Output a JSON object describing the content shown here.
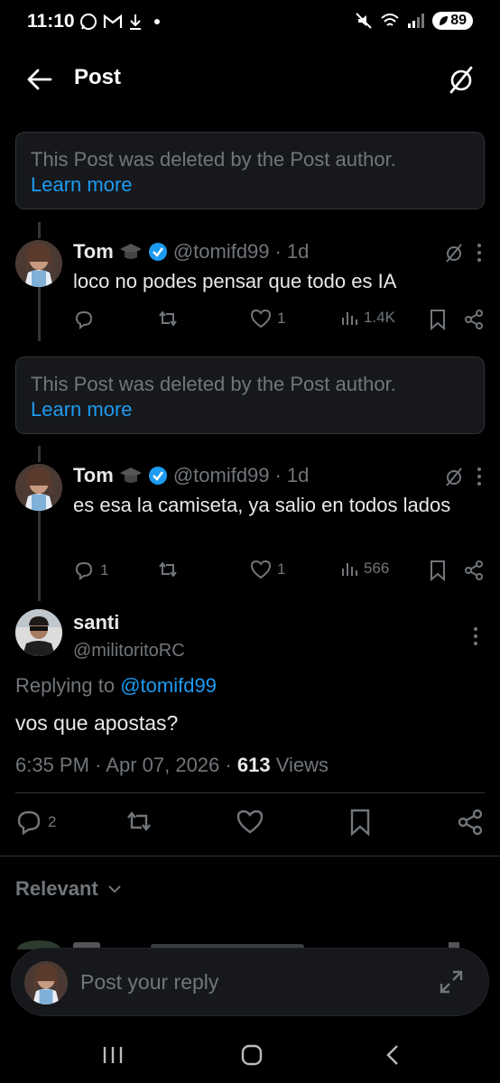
{
  "status_bar": {
    "time": "11:10",
    "battery": "89"
  },
  "header": {
    "title": "Post"
  },
  "deleted_notices": [
    {
      "text": "This Post was deleted by the Post author.",
      "link": "Learn more"
    },
    {
      "text": "This Post was deleted by the Post author.",
      "link": "Learn more"
    }
  ],
  "tweets": [
    {
      "name": "Tom",
      "handle": "@tomifd99",
      "time": "1d",
      "text": "loco no podes pensar que todo es IA",
      "replies": "",
      "likes": "1",
      "views": "1.4K"
    },
    {
      "name": "Tom",
      "handle": "@tomifd99",
      "time": "1d",
      "text": "es esa la camiseta, ya salio en todos lados",
      "replies": "1",
      "likes": "1",
      "views": "566"
    }
  ],
  "main_tweet": {
    "name": "santi",
    "handle": "@militoritoRC",
    "replying_prefix": "Replying to",
    "replying_to": "@tomifd99",
    "text": "vos que apostas?",
    "time": "6:35 PM",
    "date": "Apr 07, 2026",
    "views_count": "613",
    "views_label": "Views",
    "reply_count": "2"
  },
  "relevant_label": "Relevant",
  "reply_bar": {
    "placeholder": "Post your reply"
  },
  "colors": {
    "accent": "#1d9bf0",
    "muted": "#71767b",
    "background": "#000000"
  }
}
